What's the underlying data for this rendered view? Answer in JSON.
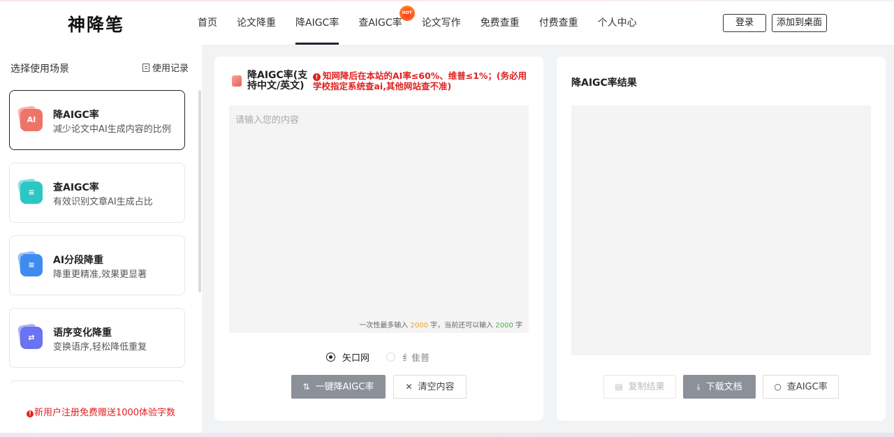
{
  "header": {
    "logo": "神降笔",
    "nav": [
      {
        "label": "首页",
        "active": false
      },
      {
        "label": "论文降重",
        "active": false
      },
      {
        "label": "降AIGC率",
        "active": true
      },
      {
        "label": "查AIGC率",
        "active": false,
        "badge": "HOT"
      },
      {
        "label": "论文写作",
        "active": false
      },
      {
        "label": "免费查重",
        "active": false
      },
      {
        "label": "付费查重",
        "active": false
      },
      {
        "label": "个人中心",
        "active": false
      }
    ],
    "login_label": "登录",
    "add_desktop_label": "添加到桌面"
  },
  "sidebar": {
    "title": "选择使用场景",
    "history_label": "使用记录",
    "scenarios": [
      {
        "name": "降AIGC率",
        "desc": "减少论文中AI生成内容的比例",
        "icon": "ai-doc-icon",
        "color": "#ee7468",
        "active": true
      },
      {
        "name": "查AIGC率",
        "desc": "有效识别文章AI生成占比",
        "icon": "scan-doc-icon",
        "color": "#2cc7c4",
        "active": false
      },
      {
        "name": "AI分段降重",
        "desc": "降重更精准,效果更显著",
        "icon": "segment-doc-icon",
        "color": "#3f8cf0",
        "active": false
      },
      {
        "name": "语序变化降重",
        "desc": "变换语序,轻松降低重复",
        "icon": "reorder-doc-icon",
        "color": "#6b73f0",
        "active": false
      }
    ],
    "promo_icon": "!",
    "promo": "新用户注册免费赠送1000体验字数"
  },
  "input_panel": {
    "title": "降AIGC率(支持中文/英文)",
    "warning_icon": "!",
    "warning": "知网降后在本站的AI率≤60%、维普≤1%；(务必用学校指定系统查ai,其他网站查不准)",
    "placeholder": "请输入您的内容",
    "value": "",
    "counter_prefix": "一次性最多输入",
    "counter_max": "2000",
    "counter_mid": "字，当前还可以输入",
    "counter_remaining": "2000",
    "counter_suffix": "字",
    "radio_options": [
      {
        "label": "矢口网",
        "selected": true
      },
      {
        "label": "纟隹普",
        "selected": false
      }
    ],
    "primary_button": "一键降AIGC率",
    "clear_button": "清空内容"
  },
  "output_panel": {
    "title": "降AIGC率结果",
    "copy_button": "复制结果",
    "download_button": "下载文档",
    "check_button": "查AIGC率"
  },
  "colors": {
    "accent": "#1f2433",
    "warning": "#e02020",
    "button_gray": "#8c9099"
  }
}
